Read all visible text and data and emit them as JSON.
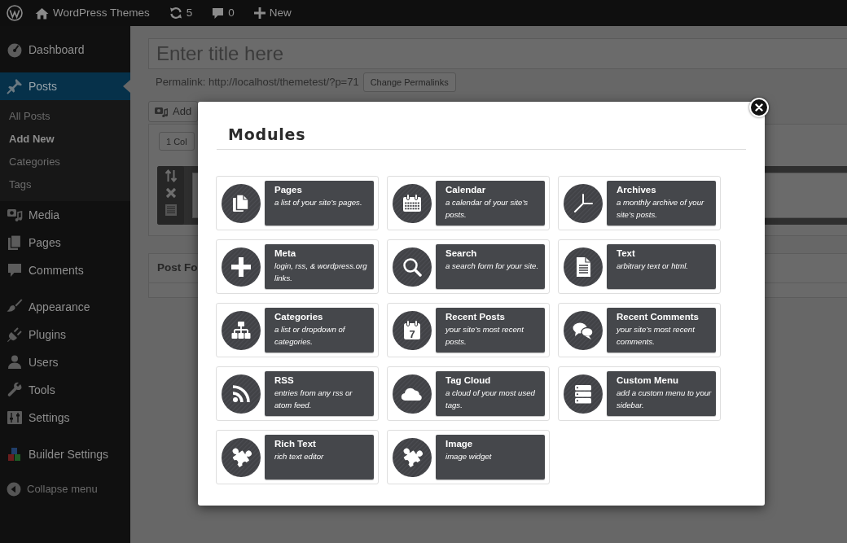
{
  "admin_bar": {
    "site_name": "WordPress Themes",
    "updates": "5",
    "comments": "0",
    "new_label": "New"
  },
  "sidebar": {
    "groups": [
      {
        "items": [
          {
            "label": "Dashboard",
            "kind": "dashboard",
            "selected": false
          }
        ]
      },
      {
        "items": [
          {
            "label": "Posts",
            "kind": "posts",
            "selected": true,
            "children": [
              {
                "label": "All Posts",
                "selected": false
              },
              {
                "label": "Add New",
                "selected": true
              },
              {
                "label": "Categories",
                "selected": false
              },
              {
                "label": "Tags",
                "selected": false
              }
            ]
          },
          {
            "label": "Media",
            "kind": "media",
            "selected": false
          },
          {
            "label": "Pages",
            "kind": "pages",
            "selected": false
          },
          {
            "label": "Comments",
            "kind": "comments",
            "selected": false
          }
        ]
      },
      {
        "items": [
          {
            "label": "Appearance",
            "kind": "appearance",
            "selected": false
          },
          {
            "label": "Plugins",
            "kind": "plugins",
            "selected": false
          },
          {
            "label": "Users",
            "kind": "users",
            "selected": false
          },
          {
            "label": "Tools",
            "kind": "tools",
            "selected": false
          },
          {
            "label": "Settings",
            "kind": "settings",
            "selected": false
          }
        ]
      },
      {
        "items": [
          {
            "label": "Builder Settings",
            "kind": "builder",
            "selected": false
          }
        ]
      }
    ],
    "collapse_label": "Collapse menu"
  },
  "editor": {
    "title_placeholder": "Enter title here",
    "permalink": "Permalink: http://localhost/themetest/?p=71",
    "change_permalinks_button": "Change Permalinks",
    "add_button": "Add",
    "column_button": "1 Col",
    "panel_title": "Post Fo"
  },
  "modal": {
    "title": "Modules",
    "modules": [
      {
        "name": "Pages",
        "description": "a list of your site’s pages.",
        "kind": "pages"
      },
      {
        "name": "Calendar",
        "description": "a calendar of your site’s posts.",
        "kind": "calendar"
      },
      {
        "name": "Archives",
        "description": "a monthly archive of your site’s posts.",
        "kind": "archives"
      },
      {
        "name": "Meta",
        "description": "login, rss, & wordpress.org links.",
        "kind": "meta"
      },
      {
        "name": "Search",
        "description": "a search form for your site.",
        "kind": "search"
      },
      {
        "name": "Text",
        "description": "arbitrary text or html.",
        "kind": "text"
      },
      {
        "name": "Categories",
        "description": "a list or dropdown of categories.",
        "kind": "categories"
      },
      {
        "name": "Recent Posts",
        "description": "your site’s most recent posts.",
        "kind": "recentposts",
        "icon_text": "7"
      },
      {
        "name": "Recent Comments",
        "description": "your site’s most recent comments.",
        "kind": "recentcomments"
      },
      {
        "name": "RSS",
        "description": "entries from any rss or atom feed.",
        "kind": "rss"
      },
      {
        "name": "Tag Cloud",
        "description": "a cloud of your most used tags.",
        "kind": "tagcloud"
      },
      {
        "name": "Custom Menu",
        "description": "add a custom menu to your sidebar.",
        "kind": "custommenu"
      },
      {
        "name": "Rich Text",
        "description": "rich text editor",
        "kind": "richtext"
      },
      {
        "name": "Image",
        "description": "image widget",
        "kind": "image"
      }
    ]
  }
}
